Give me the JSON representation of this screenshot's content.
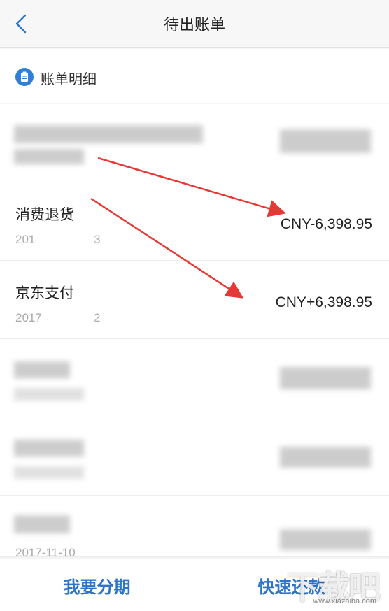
{
  "header": {
    "title": "待出账单",
    "back_icon": "chevron-left-icon"
  },
  "section": {
    "title": "账单明细",
    "icon": "clipboard-icon"
  },
  "transactions": [
    {
      "title": "",
      "date": "",
      "amount": ""
    },
    {
      "title": "消费退货",
      "date": "201",
      "date_tail": "3",
      "amount": "CNY-6,398.95"
    },
    {
      "title": "京东支付",
      "date": "2017",
      "date_tail": "2",
      "amount": "CNY+6,398.95"
    },
    {
      "title": "",
      "date": "",
      "amount": ""
    },
    {
      "title": "",
      "date": "",
      "amount": ""
    },
    {
      "title": "",
      "date": "2017-11-10",
      "amount": ""
    }
  ],
  "bottom": {
    "installment_label": "我要分期",
    "repay_label": "快速还款"
  },
  "watermark": {
    "text": "下载吧",
    "url": "www.xiazaiba.com"
  },
  "colors": {
    "accent": "#2e74c8",
    "arrow": "#e53935"
  }
}
